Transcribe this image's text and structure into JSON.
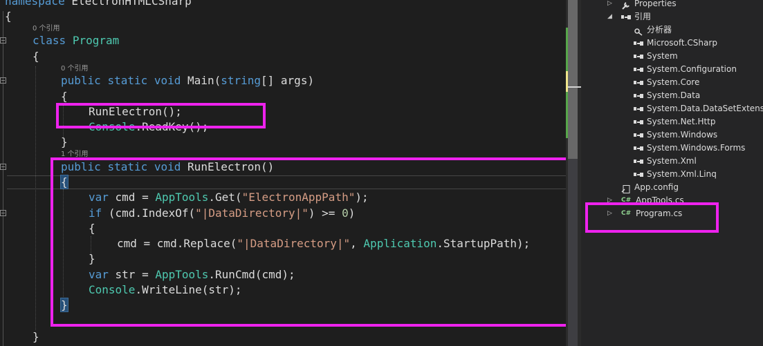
{
  "editor": {
    "lines": {
      "namespace_kw": "namespace",
      "namespace_name": "ElectronHTMLCSharp",
      "ns_open": "{",
      "lens_class": "0 个引用",
      "class_kw": "class",
      "class_name": "Program",
      "class_open": "{",
      "lens_main": "0 个引用",
      "main_sig": {
        "public": "public",
        "static": "static",
        "void": "void",
        "name": "Main(",
        "type": "string",
        "rest": "[] args)"
      },
      "main_open": "{",
      "main_call": "RunElectron();",
      "main_readkey": {
        "type": "Console",
        "rest": ".ReadKey();"
      },
      "main_close": "}",
      "lens_run": "1 个引用",
      "run_sig": {
        "public": "public",
        "static": "static",
        "void": "void",
        "name": "RunElectron()"
      },
      "run_open": "{",
      "l_var_cmd": {
        "var": "var",
        "a": " cmd = ",
        "type": "AppTools",
        "b": ".Get(",
        "str": "\"ElectronAppPath\"",
        "c": ");"
      },
      "l_if": {
        "if": "if",
        "a": " (cmd.IndexOf(",
        "str": "\"|DataDirectory|\"",
        "b": ") >= ",
        "num": "0",
        "c": ")"
      },
      "if_open": "{",
      "l_replace": {
        "a": "cmd = cmd.Replace(",
        "str": "\"|DataDirectory|\"",
        "b": ", ",
        "type": "Application",
        "c": ".StartupPath);"
      },
      "if_close": "}",
      "l_var_str": {
        "var": "var",
        "a": " str = ",
        "type": "AppTools",
        "b": ".RunCmd(cmd);"
      },
      "l_writeline": {
        "type": "Console",
        "a": ".WriteLine(str);"
      },
      "run_close": "}",
      "class_close": "}"
    }
  },
  "solution_explorer": {
    "items": [
      {
        "label": "Properties",
        "icon": "wrench-icon",
        "expandable": true,
        "expanded": false
      },
      {
        "label": "引用",
        "icon": "reference-icon",
        "expandable": true,
        "expanded": true
      },
      {
        "label": "分析器",
        "icon": "analyzer-icon"
      },
      {
        "label": "Microsoft.CSharp",
        "icon": "reference-icon"
      },
      {
        "label": "System",
        "icon": "reference-icon"
      },
      {
        "label": "System.Configuration",
        "icon": "reference-icon"
      },
      {
        "label": "System.Core",
        "icon": "reference-icon"
      },
      {
        "label": "System.Data",
        "icon": "reference-icon"
      },
      {
        "label": "System.Data.DataSetExtensions",
        "icon": "reference-icon"
      },
      {
        "label": "System.Net.Http",
        "icon": "reference-icon"
      },
      {
        "label": "System.Windows",
        "icon": "reference-icon"
      },
      {
        "label": "System.Windows.Forms",
        "icon": "reference-icon"
      },
      {
        "label": "System.Xml",
        "icon": "reference-icon"
      },
      {
        "label": "System.Xml.Linq",
        "icon": "reference-icon"
      },
      {
        "label": "App.config",
        "icon": "config-file-icon"
      },
      {
        "label": "AppTools.cs",
        "icon": "csharp-file-icon",
        "cs_badge": "C#",
        "expandable": true
      },
      {
        "label": "Program.cs",
        "icon": "csharp-file-icon",
        "cs_badge": "C#",
        "expandable": true
      }
    ]
  },
  "colors": {
    "editor_bg": "#1e1e1e",
    "explorer_bg": "#252526",
    "highlight": "#ee22ee",
    "keyword": "#569cd6",
    "type": "#4ec9b0",
    "string": "#d69d85",
    "number": "#b5cea8"
  }
}
